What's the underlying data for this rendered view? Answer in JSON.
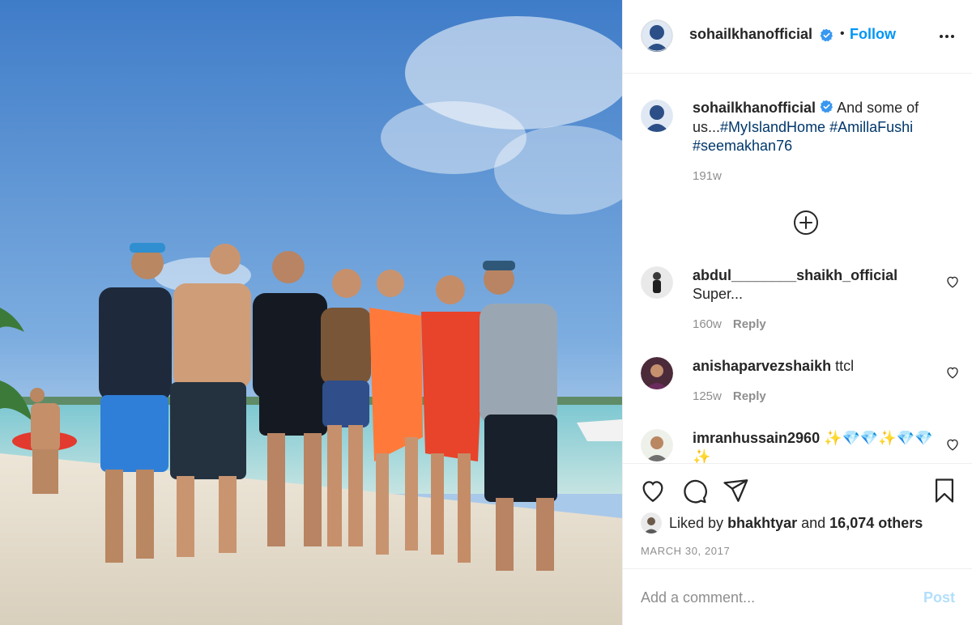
{
  "post": {
    "author": "sohailkhanofficial",
    "follow_label": "Follow",
    "separator": "•",
    "caption_text": "And some of us...",
    "hashtags": [
      "#MyIslandHome",
      "#AmillaFushi",
      "#seemakhan76"
    ],
    "caption_time": "191w"
  },
  "comments": [
    {
      "username": "abdul________shaikh_official",
      "text": "Super...",
      "time": "160w",
      "reply_label": "Reply"
    },
    {
      "username": "anishaparvezshaikh",
      "text": "ttcl",
      "time": "125w",
      "reply_label": "Reply"
    },
    {
      "username": "imranhussain2960",
      "text": "✨💎💎✨💎💎 ✨"
    }
  ],
  "likes": {
    "prefix": "Liked by",
    "user": "bhakhtyar",
    "middle": "and",
    "others": "16,074 others"
  },
  "date": "MARCH 30, 2017",
  "comment_box": {
    "placeholder": "Add a comment...",
    "post_label": "Post"
  },
  "icons": {
    "verified": "verified-badge-icon",
    "more": "more-options-icon",
    "load_more": "plus-circle-icon",
    "like": "heart-icon",
    "comment": "comment-icon",
    "share": "share-icon",
    "save": "bookmark-icon"
  },
  "colors": {
    "accent": "#0095f6",
    "hashtag": "#00376b",
    "muted": "#8e8e8e",
    "text": "#262626",
    "post_disabled": "#b2dffc"
  }
}
